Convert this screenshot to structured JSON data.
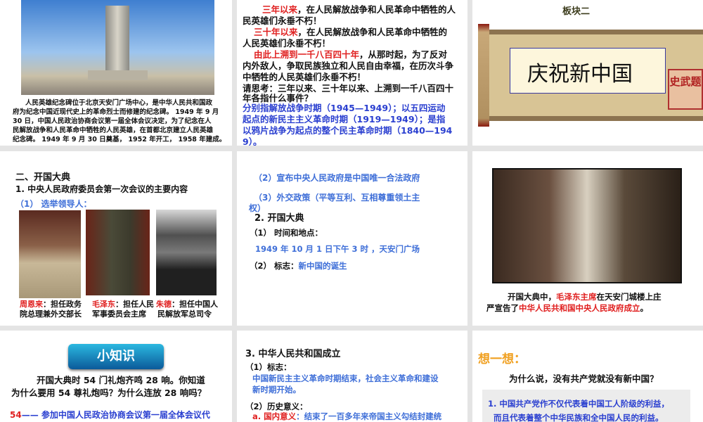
{
  "slide1": {
    "caption": [
      "人民英雄纪念碑位于北京天安门广场中心，是中华人民共和国政",
      "府为纪念中国近现代史上的革命烈士而修建的纪念碑。 1949 年 9 月",
      "30 日，中国人民政治协商会议第一届全体会议决定，为了纪念在人",
      "民解放战争和人民革命中牺牲的人民英雄，在首都北京建立人民英雄",
      "纪念碑。 1949 年 9 月 30 日奠基， 1952 年开工， 1958 年建成。"
    ]
  },
  "slide2": {
    "l1_red": "三年以来",
    "l1": "，在人民解放战争和人民革命中牺牲的人",
    "l2": "民英雄们永垂不朽！",
    "l3_red": "三十年以来",
    "l3": "，在人民解放战争和人民革命中牺牲的",
    "l4": "人民英雄们永垂不朽！",
    "l5_red": "由此上溯到一千八百四十年",
    "l5": "，从那时起，为了反对",
    "l6": "内外敌人，争取民族独立和人民自由幸福，在历次斗争",
    "l7": "中牺牲的人民英雄们永垂不朽！",
    "q1": "请思考：三年以来、三十年以来、上溯到一千八百四十",
    "q2": "年各指什么事件？",
    "a": [
      "分别指解放战争时期（1945—1949）；以五四运动",
      "起点的新民主主义革命时期（1919—1949）；是指",
      "以鸦片战争为起点的整个民主革命时期（1840—194",
      "9）。"
    ]
  },
  "slide3": {
    "section": "板块二",
    "scroll_title": "庆祝新中国",
    "seal": "史武题"
  },
  "slide4": {
    "title": "二、开国大典",
    "sub": "1. 中央人民政府委员会第一次会议的主要内容",
    "item1": "（1） 选举领导人：",
    "leaders": [
      {
        "name": "周恩来",
        "role1": "：担任政务",
        "role2": "院总理兼外交部长"
      },
      {
        "name": "毛泽东",
        "role1": "：担任人民",
        "role2": "军事委员会主席"
      },
      {
        "name": "朱德",
        "role1": "：担任中国人",
        "role2": "民解放军总司令"
      }
    ]
  },
  "slide5": {
    "item2": "（2）宣布中央人民政府是中国唯一合法政府",
    "item3a": "（3）外交政策（平等互利、互相尊重领土主",
    "item3b": "权）",
    "title2": "2. 开国大典",
    "t1": "（1） 时间和地点：",
    "t1v": "1949 年 10 月 1 日下午 3 时 ，天安门广场",
    "t2": "（2） 标志：",
    "t2v": "新中国的诞生"
  },
  "slide6": {
    "c1a": "开国大典中，",
    "c1r": "毛泽东主席",
    "c1b": "在天安门城楼上庄",
    "c2a": "严宣告了",
    "c2r": "中华人民共和国中央人民政府成立",
    "c2b": "。"
  },
  "slide7": {
    "button": "小知识",
    "p1": "开国大典时 54 门礼炮齐鸣 28 响。你知道",
    "p2": "为什么要用 54 尊礼炮吗？为什么连放 28 响吗？",
    "n54": "54",
    "n54t": "—— 参加中国人民政治协商会议第一届全体会议代"
  },
  "slide8": {
    "title": "3. 中华人民共和国成立",
    "s1": "（1）标志：",
    "s1v1": "中国新民主主义革命时期结束，社会主义革命和建设",
    "s1v2": "新时期开始。",
    "s2": "（2）历史意义：",
    "s2a": "a. 国内意义",
    "s2b": "：结束了一百多年来帝国主义勾结封建统"
  },
  "slide9": {
    "think": "想一想：",
    "q": "为什么说，没有共产党就没有新中国？",
    "a1": "1. 中国共产党作不仅代表着中国工人阶级的利益，",
    "a2": "而且代表着整个中华民族和全中国人民的利益。"
  }
}
